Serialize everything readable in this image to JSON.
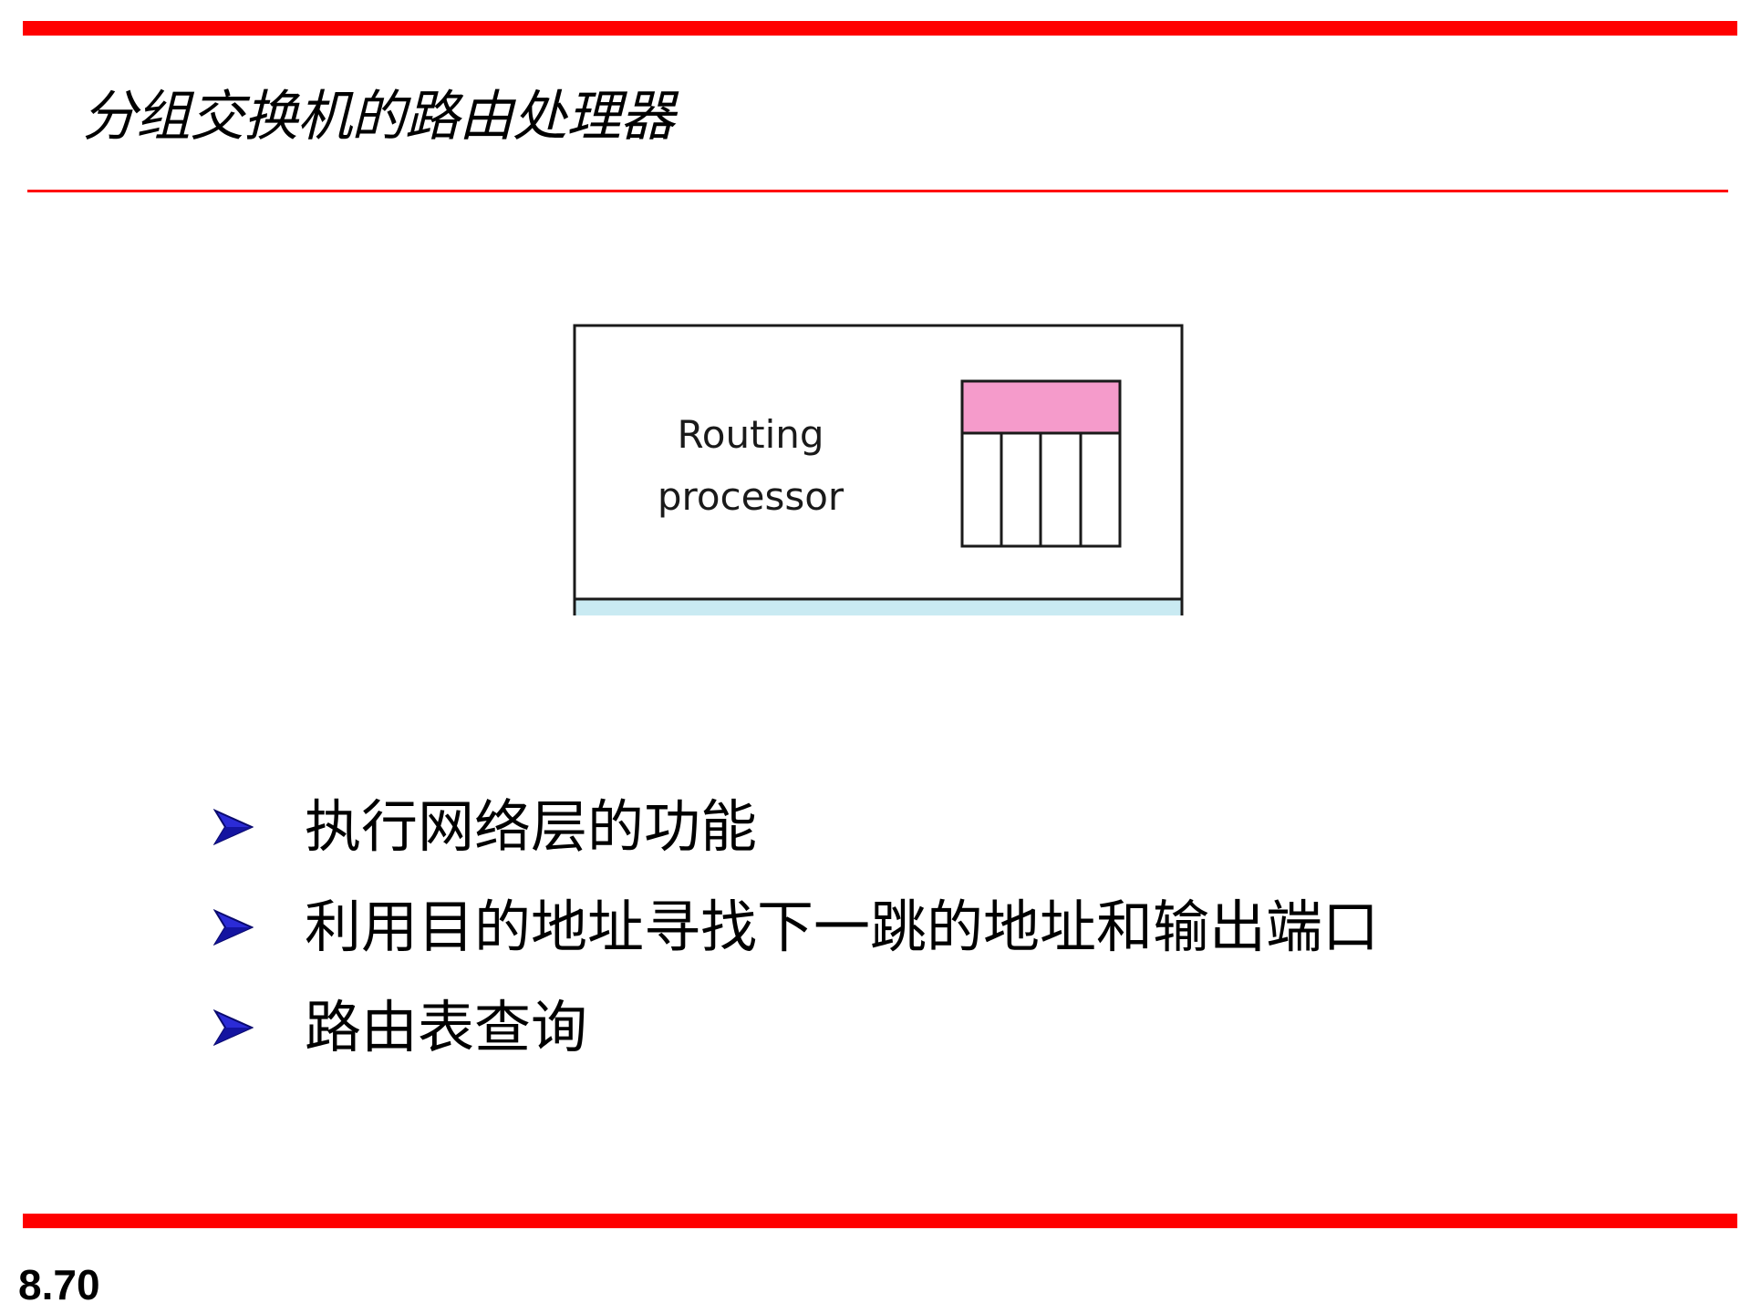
{
  "slide": {
    "title": "分组交换机的路由处理器",
    "page_number": "8.70",
    "accent_color": "#ff0000"
  },
  "diagram": {
    "label_line1": "Routing",
    "label_line2": "processor",
    "table_header_color": "#f59bcb",
    "bottom_band_color": "#c9eaf2"
  },
  "bullets": [
    {
      "text": "执行网络层的功能",
      "icon": "arrowhead-bullet-icon"
    },
    {
      "text": "利用目的地址寻找下一跳的地址和输出端口",
      "icon": "arrowhead-bullet-icon"
    },
    {
      "text": "路由表查询",
      "icon": "arrowhead-bullet-icon"
    }
  ]
}
